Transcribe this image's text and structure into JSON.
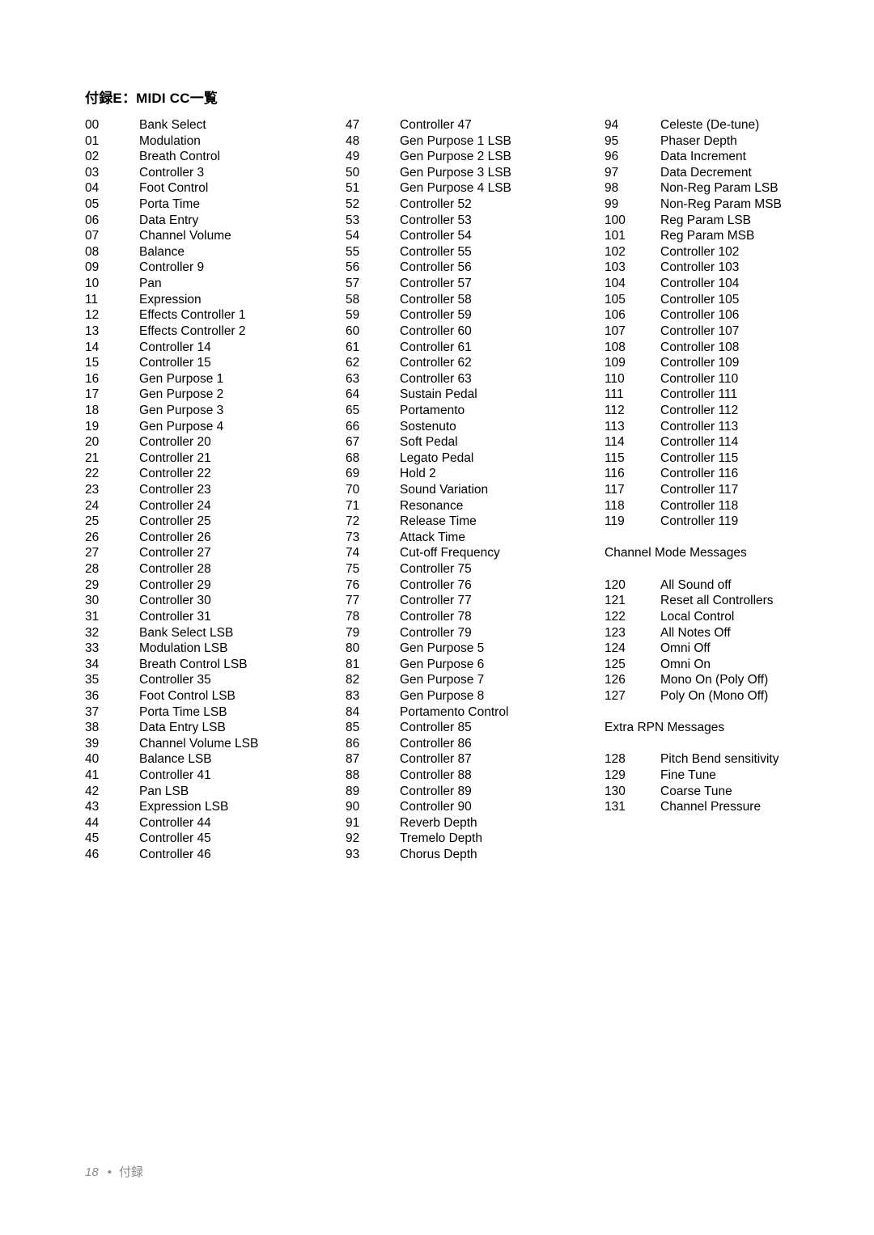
{
  "document": {
    "title": "付録E：MIDI CC一覧",
    "footer": {
      "page_number": "18",
      "separator": "•",
      "section": "付録"
    }
  },
  "columns": [
    {
      "id": "column-1",
      "rows": [
        {
          "num": "00",
          "label": "Bank Select"
        },
        {
          "num": "01",
          "label": "Modulation"
        },
        {
          "num": "02",
          "label": "Breath Control"
        },
        {
          "num": "03",
          "label": "Controller 3"
        },
        {
          "num": "04",
          "label": "Foot Control"
        },
        {
          "num": "05",
          "label": "Porta Time"
        },
        {
          "num": "06",
          "label": "Data Entry"
        },
        {
          "num": "07",
          "label": "Channel Volume"
        },
        {
          "num": "08",
          "label": "Balance"
        },
        {
          "num": "09",
          "label": "Controller 9"
        },
        {
          "num": "10",
          "label": "Pan"
        },
        {
          "num": "11",
          "label": "Expression"
        },
        {
          "num": "12",
          "label": "Effects Controller 1"
        },
        {
          "num": "13",
          "label": "Effects Controller 2"
        },
        {
          "num": "14",
          "label": "Controller 14"
        },
        {
          "num": "15",
          "label": "Controller 15"
        },
        {
          "num": "16",
          "label": "Gen Purpose 1"
        },
        {
          "num": "17",
          "label": "Gen Purpose 2"
        },
        {
          "num": "18",
          "label": "Gen Purpose 3"
        },
        {
          "num": "19",
          "label": "Gen Purpose 4"
        },
        {
          "num": "20",
          "label": "Controller 20"
        },
        {
          "num": "21",
          "label": "Controller 21"
        },
        {
          "num": "22",
          "label": "Controller 22"
        },
        {
          "num": "23",
          "label": "Controller 23"
        },
        {
          "num": "24",
          "label": "Controller 24"
        },
        {
          "num": "25",
          "label": "Controller 25"
        },
        {
          "num": "26",
          "label": "Controller 26"
        },
        {
          "num": "27",
          "label": "Controller 27"
        },
        {
          "num": "28",
          "label": "Controller 28"
        },
        {
          "num": "29",
          "label": "Controller 29"
        },
        {
          "num": "30",
          "label": "Controller 30"
        },
        {
          "num": "31",
          "label": "Controller 31"
        },
        {
          "num": "32",
          "label": "Bank Select LSB"
        },
        {
          "num": "33",
          "label": "Modulation LSB"
        },
        {
          "num": "34",
          "label": "Breath Control LSB"
        },
        {
          "num": "35",
          "label": "Controller 35"
        },
        {
          "num": "36",
          "label": "Foot Control LSB"
        },
        {
          "num": "37",
          "label": "Porta Time LSB"
        },
        {
          "num": "38",
          "label": "Data Entry LSB"
        },
        {
          "num": "39",
          "label": "Channel Volume LSB"
        },
        {
          "num": "40",
          "label": "Balance LSB"
        },
        {
          "num": "41",
          "label": "Controller 41"
        },
        {
          "num": "42",
          "label": "Pan LSB"
        },
        {
          "num": "43",
          "label": "Expression LSB"
        },
        {
          "num": "44",
          "label": "Controller 44"
        },
        {
          "num": "45",
          "label": "Controller 45"
        },
        {
          "num": "46",
          "label": "Controller 46"
        }
      ]
    },
    {
      "id": "column-2",
      "rows": [
        {
          "num": "47",
          "label": "Controller 47"
        },
        {
          "num": "48",
          "label": "Gen Purpose 1 LSB"
        },
        {
          "num": "49",
          "label": "Gen Purpose 2 LSB"
        },
        {
          "num": "50",
          "label": "Gen Purpose 3 LSB"
        },
        {
          "num": "51",
          "label": "Gen Purpose 4 LSB"
        },
        {
          "num": "52",
          "label": "Controller 52"
        },
        {
          "num": "53",
          "label": "Controller 53"
        },
        {
          "num": "54",
          "label": "Controller 54"
        },
        {
          "num": "55",
          "label": "Controller 55"
        },
        {
          "num": "56",
          "label": "Controller 56"
        },
        {
          "num": "57",
          "label": "Controller 57"
        },
        {
          "num": "58",
          "label": "Controller 58"
        },
        {
          "num": "59",
          "label": "Controller 59"
        },
        {
          "num": "60",
          "label": "Controller 60"
        },
        {
          "num": "61",
          "label": "Controller 61"
        },
        {
          "num": "62",
          "label": "Controller 62"
        },
        {
          "num": "63",
          "label": "Controller 63"
        },
        {
          "num": "64",
          "label": "Sustain Pedal"
        },
        {
          "num": "65",
          "label": "Portamento"
        },
        {
          "num": "66",
          "label": "Sostenuto"
        },
        {
          "num": "67",
          "label": "Soft Pedal"
        },
        {
          "num": "68",
          "label": "Legato Pedal"
        },
        {
          "num": "69",
          "label": "Hold 2"
        },
        {
          "num": "70",
          "label": "Sound Variation"
        },
        {
          "num": "71",
          "label": "Resonance"
        },
        {
          "num": "72",
          "label": "Release Time"
        },
        {
          "num": "73",
          "label": "Attack Time"
        },
        {
          "num": "74",
          "label": "Cut-off Frequency"
        },
        {
          "num": "75",
          "label": "Controller 75"
        },
        {
          "num": "76",
          "label": "Controller 76"
        },
        {
          "num": "77",
          "label": "Controller 77"
        },
        {
          "num": "78",
          "label": "Controller 78"
        },
        {
          "num": "79",
          "label": "Controller 79"
        },
        {
          "num": "80",
          "label": "Gen Purpose 5"
        },
        {
          "num": "81",
          "label": "Gen Purpose 6"
        },
        {
          "num": "82",
          "label": "Gen Purpose 7"
        },
        {
          "num": "83",
          "label": "Gen Purpose 8"
        },
        {
          "num": "84",
          "label": "Portamento Control"
        },
        {
          "num": "85",
          "label": "Controller 85"
        },
        {
          "num": "86",
          "label": "Controller 86"
        },
        {
          "num": "87",
          "label": "Controller 87"
        },
        {
          "num": "88",
          "label": "Controller 88"
        },
        {
          "num": "89",
          "label": "Controller 89"
        },
        {
          "num": "90",
          "label": "Controller 90"
        },
        {
          "num": "91",
          "label": "Reverb Depth"
        },
        {
          "num": "92",
          "label": "Tremelo Depth"
        },
        {
          "num": "93",
          "label": "Chorus Depth"
        }
      ]
    },
    {
      "id": "column-3",
      "rows": [
        {
          "num": "94",
          "label": "Celeste (De-tune)"
        },
        {
          "num": "95",
          "label": "Phaser Depth"
        },
        {
          "num": "96",
          "label": "Data Increment"
        },
        {
          "num": "97",
          "label": "Data Decrement"
        },
        {
          "num": "98",
          "label": "Non-Reg Param LSB"
        },
        {
          "num": "99",
          "label": "Non-Reg Param MSB"
        },
        {
          "num": "100",
          "label": "Reg Param LSB"
        },
        {
          "num": "101",
          "label": "Reg Param MSB"
        },
        {
          "num": "102",
          "label": "Controller 102"
        },
        {
          "num": "103",
          "label": "Controller 103"
        },
        {
          "num": "104",
          "label": "Controller 104"
        },
        {
          "num": "105",
          "label": "Controller 105"
        },
        {
          "num": "106",
          "label": "Controller 106"
        },
        {
          "num": "107",
          "label": "Controller 107"
        },
        {
          "num": "108",
          "label": "Controller 108"
        },
        {
          "num": "109",
          "label": "Controller 109"
        },
        {
          "num": "110",
          "label": "Controller 110"
        },
        {
          "num": "111",
          "label": "Controller 111"
        },
        {
          "num": "112",
          "label": "Controller 112"
        },
        {
          "num": "113",
          "label": "Controller 113"
        },
        {
          "num": "114",
          "label": "Controller 114"
        },
        {
          "num": "115",
          "label": "Controller 115"
        },
        {
          "num": "116",
          "label": "Controller 116"
        },
        {
          "num": "117",
          "label": "Controller 117"
        },
        {
          "num": "118",
          "label": "Controller 118"
        },
        {
          "num": "119",
          "label": "Controller 119"
        },
        {
          "spacer": true
        },
        {
          "section": "Channel Mode Messages"
        },
        {
          "spacer": true
        },
        {
          "num": "120",
          "label": "All Sound off"
        },
        {
          "num": "121",
          "label": "Reset all Controllers"
        },
        {
          "num": "122",
          "label": "Local Control"
        },
        {
          "num": "123",
          "label": "All Notes Off"
        },
        {
          "num": "124",
          "label": "Omni Off"
        },
        {
          "num": "125",
          "label": "Omni On"
        },
        {
          "num": "126",
          "label": "Mono On (Poly Off)"
        },
        {
          "num": "127",
          "label": "Poly On (Mono Off)"
        },
        {
          "spacer": true
        },
        {
          "section": "Extra RPN Messages"
        },
        {
          "spacer": true
        },
        {
          "num": "128",
          "label": "Pitch Bend sensitivity",
          "narrow": true
        },
        {
          "num": "129",
          "label": "Fine Tune",
          "narrow": true
        },
        {
          "num": "130",
          "label": "Coarse Tune",
          "narrow": true
        },
        {
          "num": "131",
          "label": "Channel Pressure",
          "narrow": true
        }
      ]
    }
  ]
}
